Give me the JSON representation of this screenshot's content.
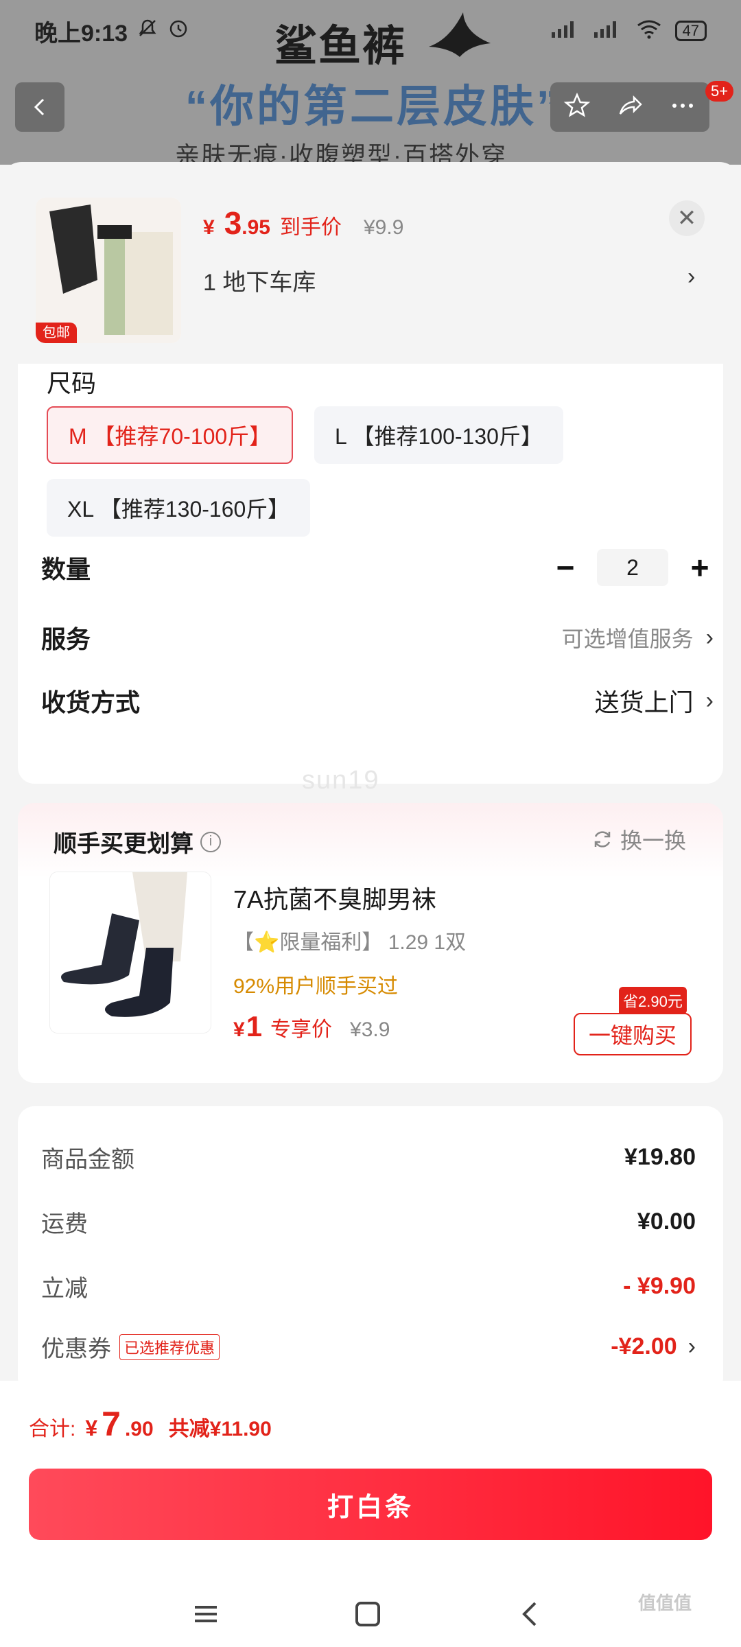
{
  "status_bar": {
    "time": "晚上9:13",
    "battery": "47"
  },
  "background": {
    "brand": "鲨鱼裤",
    "slogan": "“你的第二层皮肤”",
    "subslogan": "亲肤无痕·收腹塑型·百搭外穿",
    "badge": "5+"
  },
  "product": {
    "thumb_tag": "包邮",
    "price_yen": "¥",
    "price_int": "3",
    "price_dec": ".95",
    "price_label": "到手价",
    "original_price": "¥9.9",
    "address": "1  地下车库"
  },
  "size": {
    "label": "尺码",
    "options": [
      {
        "label": "M 【推荐70-100斤】",
        "selected": true
      },
      {
        "label": "L 【推荐100-130斤】",
        "selected": false
      },
      {
        "label": "XL 【推荐130-160斤】",
        "selected": false
      }
    ]
  },
  "quantity": {
    "label": "数量",
    "value": "2",
    "minus": "−",
    "plus": "+"
  },
  "service": {
    "label": "服务",
    "value": "可选增值服务"
  },
  "delivery": {
    "label": "收货方式",
    "value": "送货上门"
  },
  "watermark": "sun19",
  "addon": {
    "title": "顺手买更划算",
    "swap": "换一换",
    "name": "7A抗菌不臭脚男袜",
    "desc": "【⭐限量福利】 1.29 1双",
    "bought": "92%用户顺手买过",
    "price_yen": "¥",
    "price": "1",
    "price_label": "专享价",
    "original": "¥3.9",
    "save_tag": "省2.90元",
    "buy_button": "一键购买"
  },
  "summary": {
    "goods": {
      "label": "商品金额",
      "value": "¥19.80"
    },
    "shipping": {
      "label": "运费",
      "value": "¥0.00"
    },
    "discount": {
      "label": "立减",
      "value": "- ¥9.90"
    },
    "coupon": {
      "label": "优惠券",
      "tag": "已选推荐优惠",
      "value": "-¥2.00"
    }
  },
  "footer": {
    "total_label": "合计:",
    "total_yen": "¥",
    "total_int": "7",
    "total_dec": ".90",
    "total_saved": "共减¥11.90",
    "pay_button": "打白条"
  },
  "corner_watermark": "值值值",
  "colors": {
    "accent": "#e2231a",
    "muted": "#888888",
    "orange": "#d68a00"
  }
}
